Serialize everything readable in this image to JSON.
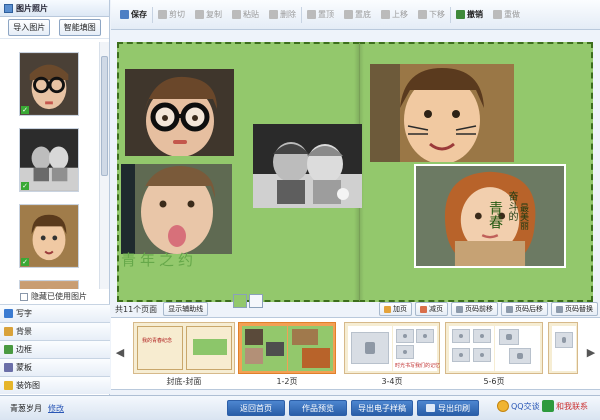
{
  "left_panel": {
    "title": "图片照片",
    "import_button": "导入图片",
    "smart_fill_button": "智能填图",
    "hide_used_label": "隐藏已使用图片",
    "categories": [
      {
        "label": "写字",
        "icon": "text-T-icon",
        "color": "#3b7bd1"
      },
      {
        "label": "背景",
        "icon": "background-icon",
        "color": "#d9a23a"
      },
      {
        "label": "边框",
        "icon": "frame-icon",
        "color": "#4a9a41"
      },
      {
        "label": "蒙板",
        "icon": "mask-icon",
        "color": "#6b6fa8"
      },
      {
        "label": "装饰图",
        "icon": "star-icon",
        "color": "#e6b52a"
      }
    ]
  },
  "toolbar": {
    "save": "保存",
    "cut": "剪切",
    "copy": "复制",
    "paste": "粘贴",
    "delete": "删除",
    "top": "置顶",
    "bottom": "置底",
    "up": "上移",
    "down": "下移",
    "undo": "撤销",
    "redo": "重做"
  },
  "canvas": {
    "title_line1": "奋斗的",
    "title_line2": "青春",
    "title_line3": "最美丽",
    "watermark": "青年之约"
  },
  "strip": {
    "count_label": "共11个页面",
    "assist_lines_button": "显示辅助线",
    "add_page": "加页",
    "delete_page": "减页",
    "move_front": "页码前移",
    "move_back": "页码后移",
    "swap_page": "页码替换",
    "pages": [
      {
        "label": "封底-封面",
        "cover_text": "我的青春纪念"
      },
      {
        "label": "1-2页",
        "selected": true
      },
      {
        "label": "3-4页",
        "caption": "时光书写我们的记忆"
      },
      {
        "label": "5-6页"
      }
    ]
  },
  "bottom": {
    "user_name": "青葱岁月",
    "edit_link": "修改",
    "home_button": "返回首页",
    "preview_button": "作品预览",
    "export_ebook_button": "导出电子样稿",
    "export_print_button": "导出印刷",
    "qq_chat": "QQ交谈",
    "contact_us": "和我联系"
  }
}
